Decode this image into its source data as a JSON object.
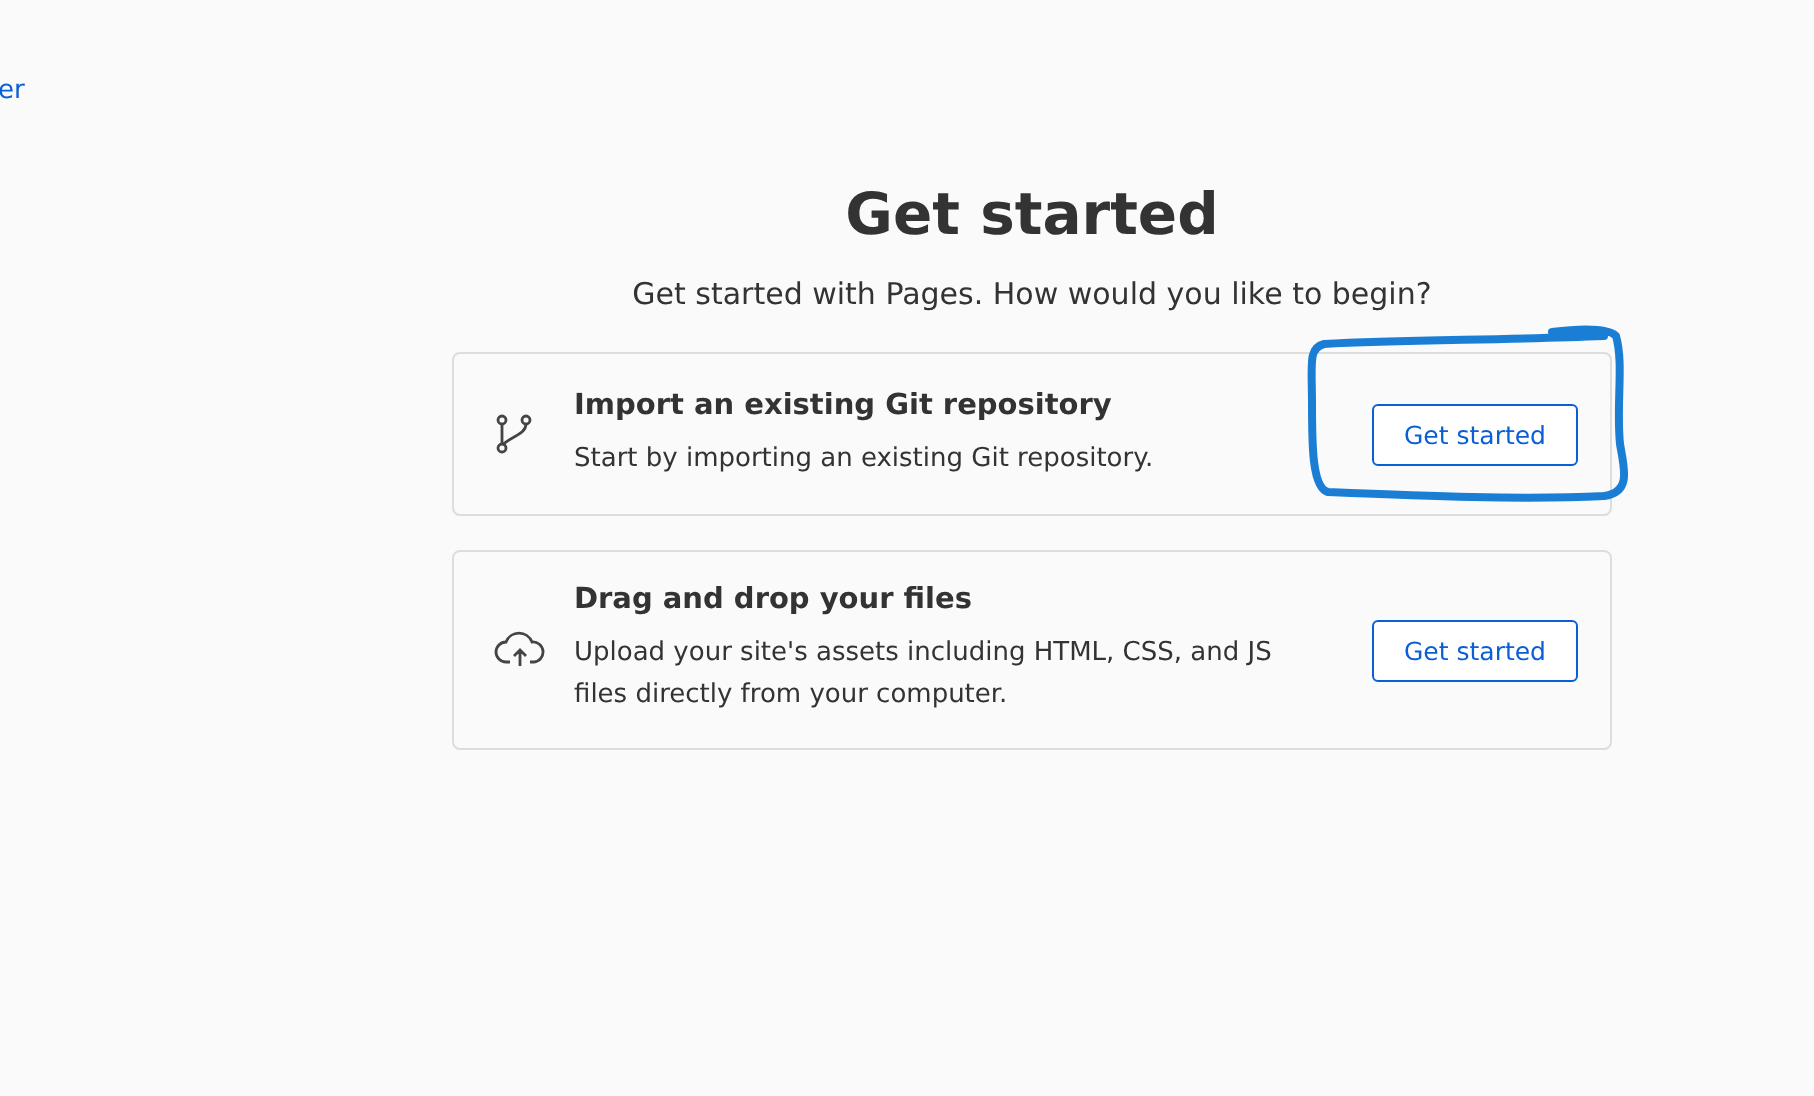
{
  "top_link": "er",
  "heading": "Get started",
  "subtitle": "Get started with Pages. How would you like to begin?",
  "options": [
    {
      "kind": "git",
      "title": "Import an existing Git repository",
      "description": "Start by importing an existing Git repository.",
      "button": "Get started",
      "annotated": true
    },
    {
      "kind": "upload",
      "title": "Drag and drop your files",
      "description": "Upload your site's assets including HTML, CSS, and JS files directly from your computer.",
      "button": "Get started",
      "annotated": false
    }
  ]
}
